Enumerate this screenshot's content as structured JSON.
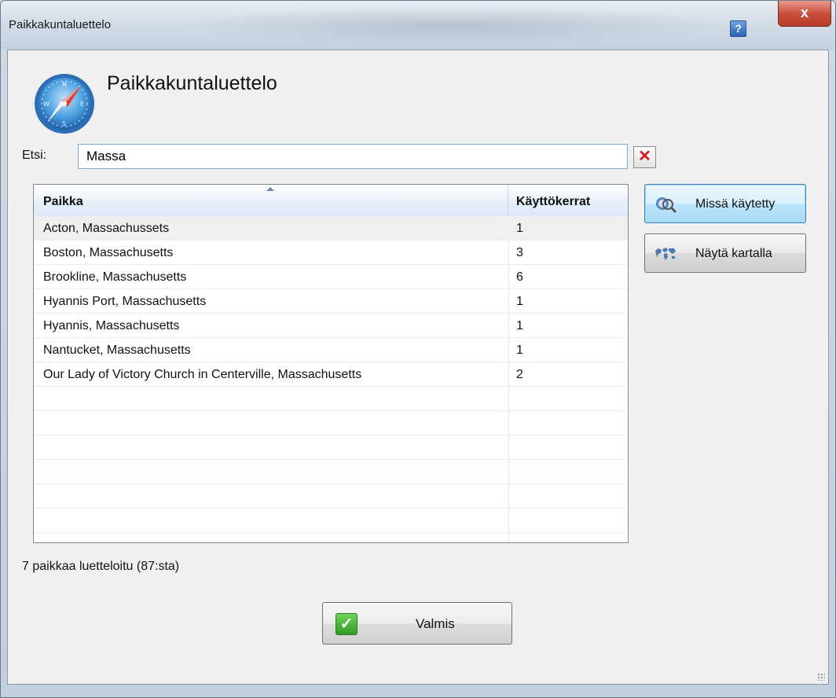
{
  "window": {
    "title": "Paikkakuntaluettelo",
    "help_label": "?",
    "close_label": "x"
  },
  "header": {
    "title": "Paikkakuntaluettelo",
    "icon": "compass-icon"
  },
  "search": {
    "label": "Etsi:",
    "value": "Massa",
    "clear_label": "✕"
  },
  "table": {
    "columns": [
      "Paikka",
      "Käyttökerrat"
    ],
    "sorted_by": "Paikka",
    "rows": [
      {
        "place": "Acton, Massachussets",
        "count": "1"
      },
      {
        "place": "Boston, Massachusetts",
        "count": "3"
      },
      {
        "place": "Brookline, Massachusetts",
        "count": "6"
      },
      {
        "place": "Hyannis Port, Massachusetts",
        "count": "1"
      },
      {
        "place": "Hyannis, Massachusetts",
        "count": "1"
      },
      {
        "place": "Nantucket, Massachusetts",
        "count": "1"
      },
      {
        "place": "Our Lady of Victory Church in Centerville, Massachusetts",
        "count": "2"
      },
      {
        "place": "",
        "count": ""
      },
      {
        "place": "",
        "count": ""
      },
      {
        "place": "",
        "count": ""
      },
      {
        "place": "",
        "count": ""
      },
      {
        "place": "",
        "count": ""
      },
      {
        "place": "",
        "count": ""
      }
    ]
  },
  "actions": {
    "where_used": {
      "label": "Missä käytetty",
      "icon": "search-usage-icon"
    },
    "show_on_map": {
      "label": "Näytä kartalla",
      "icon": "world-map-icon"
    }
  },
  "status": "7 paikkaa luetteloitu (87:sta)",
  "footer": {
    "done_label": "Valmis",
    "done_icon": "checkmark-icon"
  },
  "colors": {
    "accent": "#3c7fb1",
    "clear_red": "#d21b1b",
    "check_green": "#2f9b23"
  }
}
